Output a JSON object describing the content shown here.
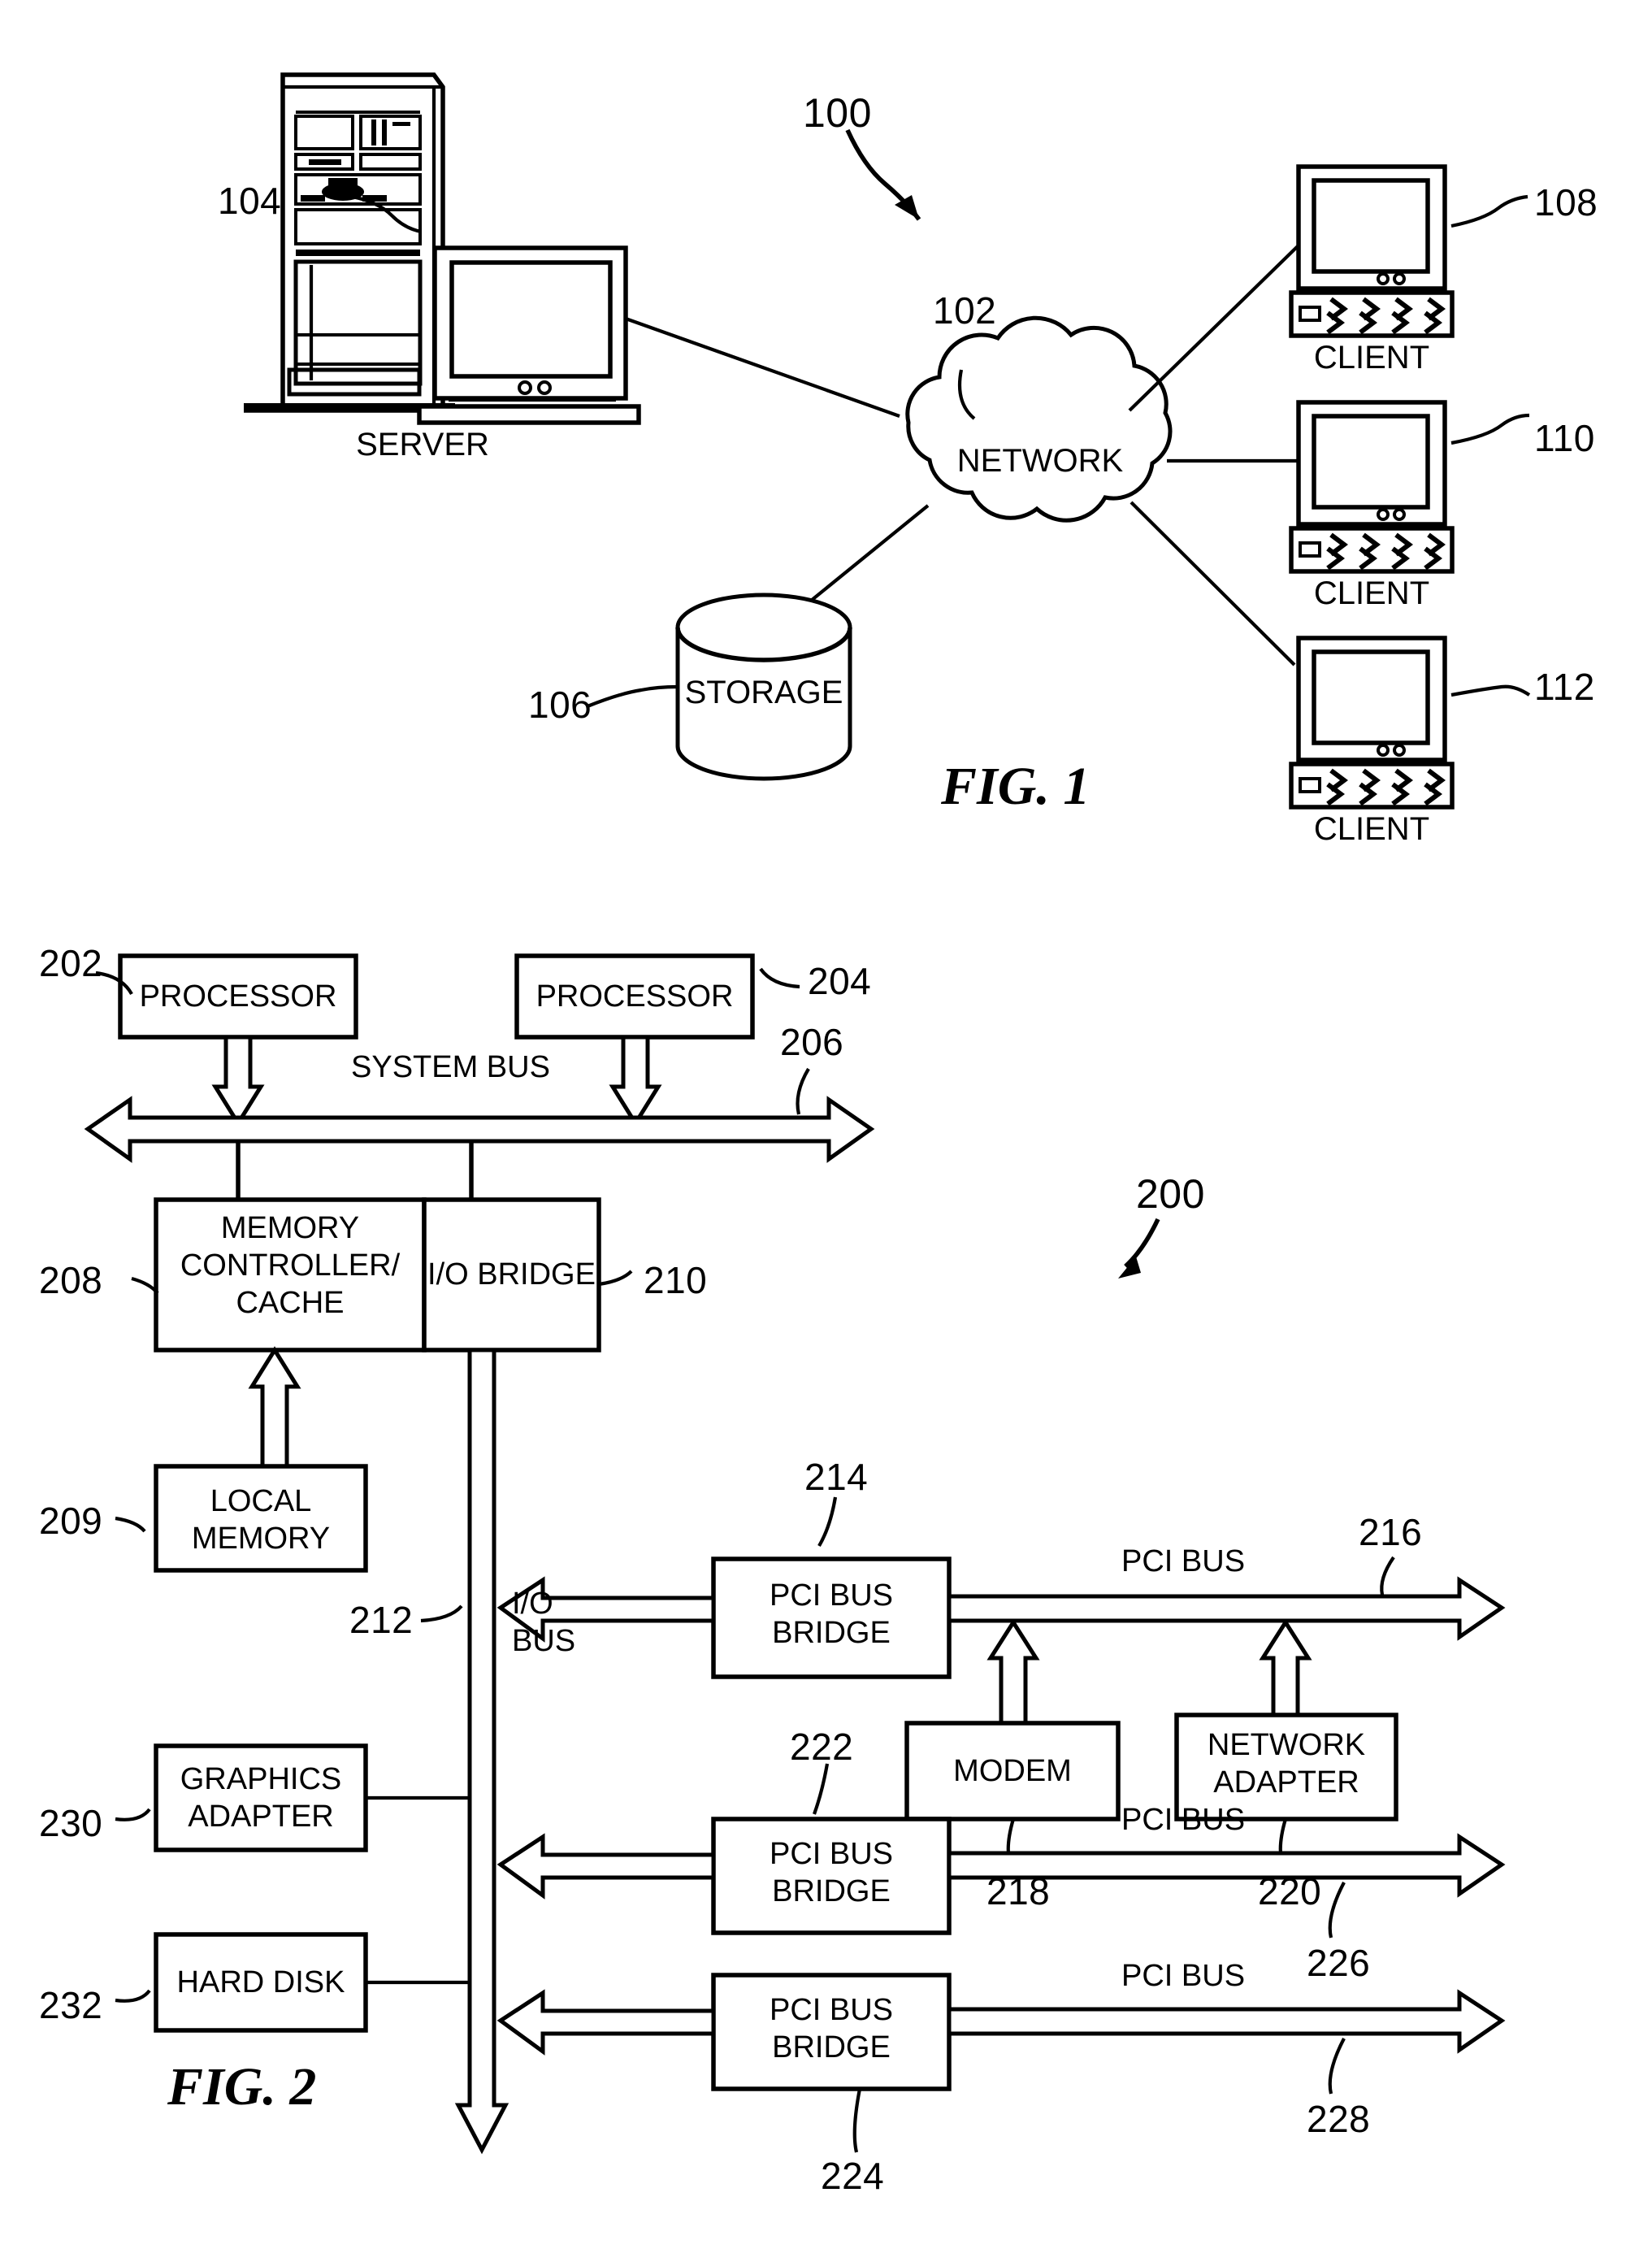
{
  "figure1": {
    "caption": "FIG. 1",
    "system_ref": "100",
    "nodes": {
      "server": {
        "label": "SERVER",
        "ref": "104"
      },
      "network": {
        "label": "NETWORK",
        "ref": "102"
      },
      "storage": {
        "label": "STORAGE",
        "ref": "106"
      },
      "client1": {
        "label": "CLIENT",
        "ref": "108"
      },
      "client2": {
        "label": "CLIENT",
        "ref": "110"
      },
      "client3": {
        "label": "CLIENT",
        "ref": "112"
      }
    }
  },
  "figure2": {
    "caption": "FIG. 2",
    "system_ref": "200",
    "blocks": {
      "processor1": {
        "label": "PROCESSOR",
        "ref": "202"
      },
      "processor2": {
        "label": "PROCESSOR",
        "ref": "204"
      },
      "memory_controller": {
        "label": "MEMORY\nCONTROLLER/\nCACHE",
        "ref": "208"
      },
      "io_bridge": {
        "label": "I/O BRIDGE",
        "ref": "210"
      },
      "local_memory": {
        "label": "LOCAL\nMEMORY",
        "ref": "209"
      },
      "graphics_adapter": {
        "label": "GRAPHICS\nADAPTER",
        "ref": "230"
      },
      "hard_disk": {
        "label": "HARD DISK",
        "ref": "232"
      },
      "pci_bridge1": {
        "label": "PCI BUS\nBRIDGE",
        "ref": "214"
      },
      "pci_bridge2": {
        "label": "PCI BUS\nBRIDGE",
        "ref": "222"
      },
      "pci_bridge3": {
        "label": "PCI BUS\nBRIDGE",
        "ref": "224"
      },
      "modem": {
        "label": "MODEM",
        "ref": "218"
      },
      "network_adapter": {
        "label": "NETWORK\nADAPTER",
        "ref": "220"
      }
    },
    "buses": {
      "system_bus": {
        "label": "SYSTEM BUS",
        "ref": "206"
      },
      "io_bus": {
        "label": "I/O\nBUS",
        "ref": "212"
      },
      "pci_bus1": {
        "label": "PCI BUS",
        "ref": "216"
      },
      "pci_bus2": {
        "label": "PCI BUS",
        "ref": "226"
      },
      "pci_bus3": {
        "label": "PCI BUS",
        "ref": "228"
      }
    }
  }
}
